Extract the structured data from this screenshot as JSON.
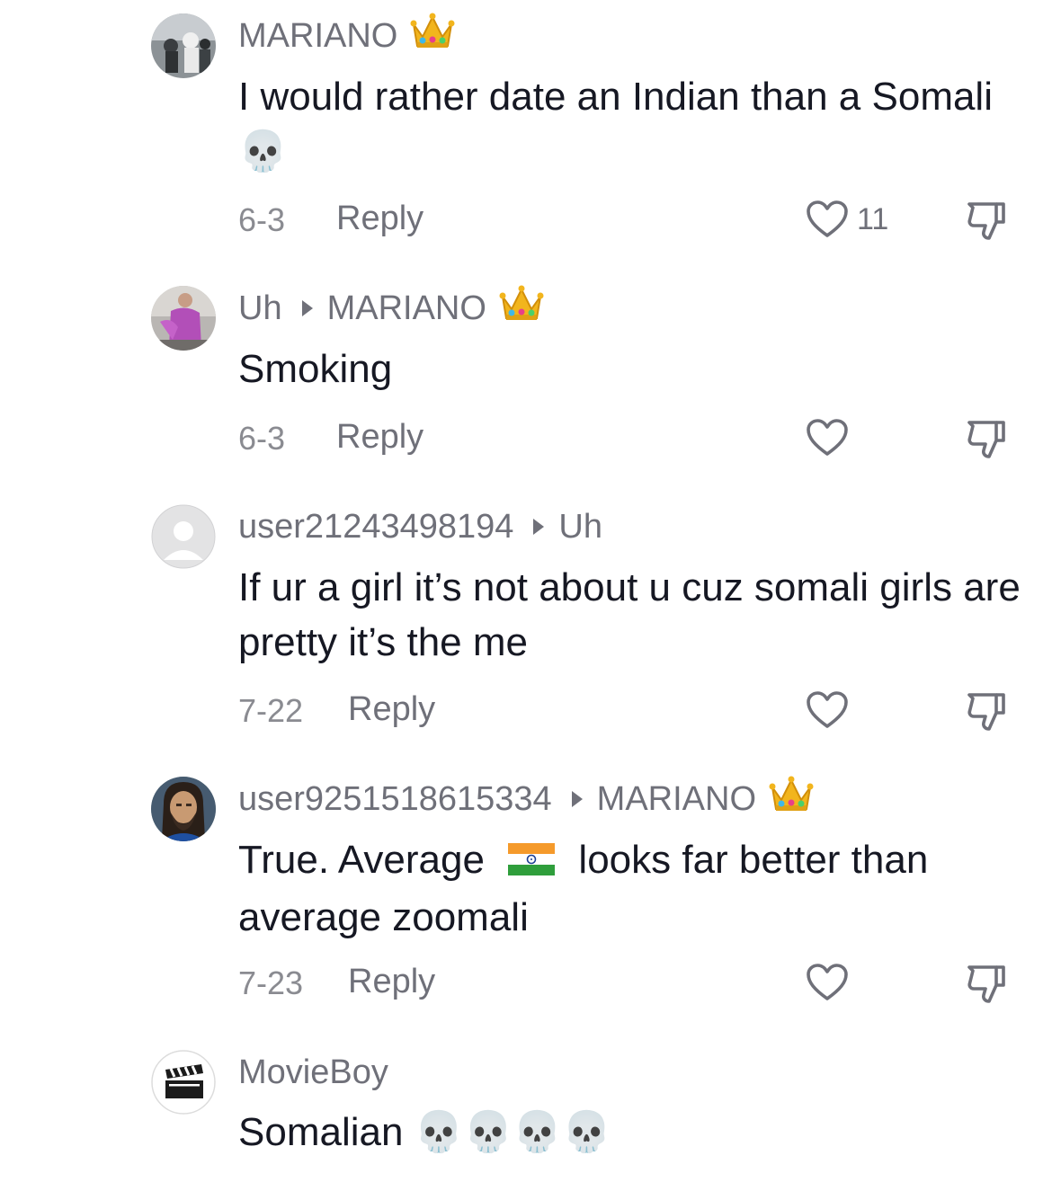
{
  "comments": [
    {
      "user": "MARIANO",
      "reply_to": "",
      "text": "I would rather date an Indian than a Somali 💀",
      "date": "6-3",
      "reply_label": "Reply",
      "likes": "11"
    },
    {
      "user": "Uh",
      "reply_to": "MARIANO",
      "text": "Smoking",
      "date": "6-3",
      "reply_label": "Reply",
      "likes": ""
    },
    {
      "user": "user21243498194",
      "reply_to": "Uh",
      "text": "If ur a girl it’s not about u cuz somali girls are pretty it’s the me",
      "date": "7-22",
      "reply_label": "Reply",
      "likes": ""
    },
    {
      "user": "user9251518615334",
      "reply_to": "MARIANO",
      "text_before_flag": "True. Average",
      "text_after_flag": "looks far better than average zoomali",
      "date": "7-23",
      "reply_label": "Reply",
      "likes": ""
    },
    {
      "user": "MovieBoy",
      "reply_to": "",
      "text": "Somalian 💀💀💀💀",
      "date": "",
      "reply_label": "",
      "likes": ""
    }
  ],
  "icons": {
    "crown": "crown-emoji",
    "skull": "skull-emoji",
    "flag": "india-flag-emoji",
    "like": "heart-outline-icon",
    "dislike": "thumbs-down-icon"
  },
  "colors": {
    "username": "#6f7079",
    "text": "#161823",
    "meta": "#8a8b91"
  }
}
